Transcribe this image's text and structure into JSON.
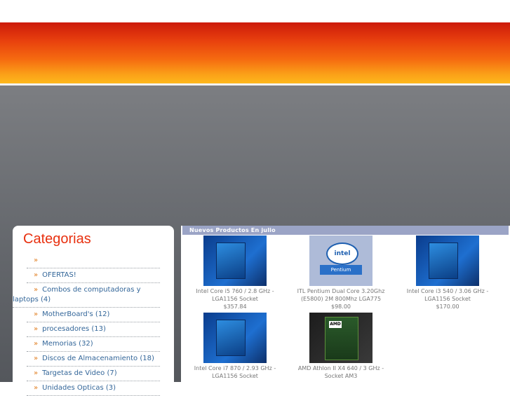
{
  "sidebar": {
    "title": "Categorias",
    "bullet": "»",
    "items": [
      {
        "label": ""
      },
      {
        "label": "OFERTAS!"
      },
      {
        "label": "Combos de computadoras y laptops (4)"
      },
      {
        "label": "MotherBoard's (12)"
      },
      {
        "label": "procesadores (13)"
      },
      {
        "label": "Memorias (32)"
      },
      {
        "label": "Discos de Almacenamiento (18)"
      },
      {
        "label": "Targetas de Video (7)"
      },
      {
        "label": "Unidades Opticas (3)"
      }
    ]
  },
  "products": {
    "header": "Nuevos Productos En julio",
    "items": [
      {
        "name": "Intel Core i5 760 / 2.8 GHz - LGA1156 Socket",
        "price": "$357.84"
      },
      {
        "name": "ITL Pentium Dual Core 3.20Ghz (E5800) 2M 800Mhz LGA775",
        "price": "$98.00",
        "logo_text": "intel",
        "box_text": "Pentium"
      },
      {
        "name": "Intel Core i3 540 / 3.06 GHz - LGA1156 Socket",
        "price": "$170.00"
      },
      {
        "name": "Intel Core i7 870 / 2.93 GHz - LGA1156 Socket",
        "price": ""
      },
      {
        "name": "AMD Athlon II X4 640 / 3 GHz - Socket AM3",
        "price": "",
        "logo_text": "AMD"
      }
    ]
  }
}
